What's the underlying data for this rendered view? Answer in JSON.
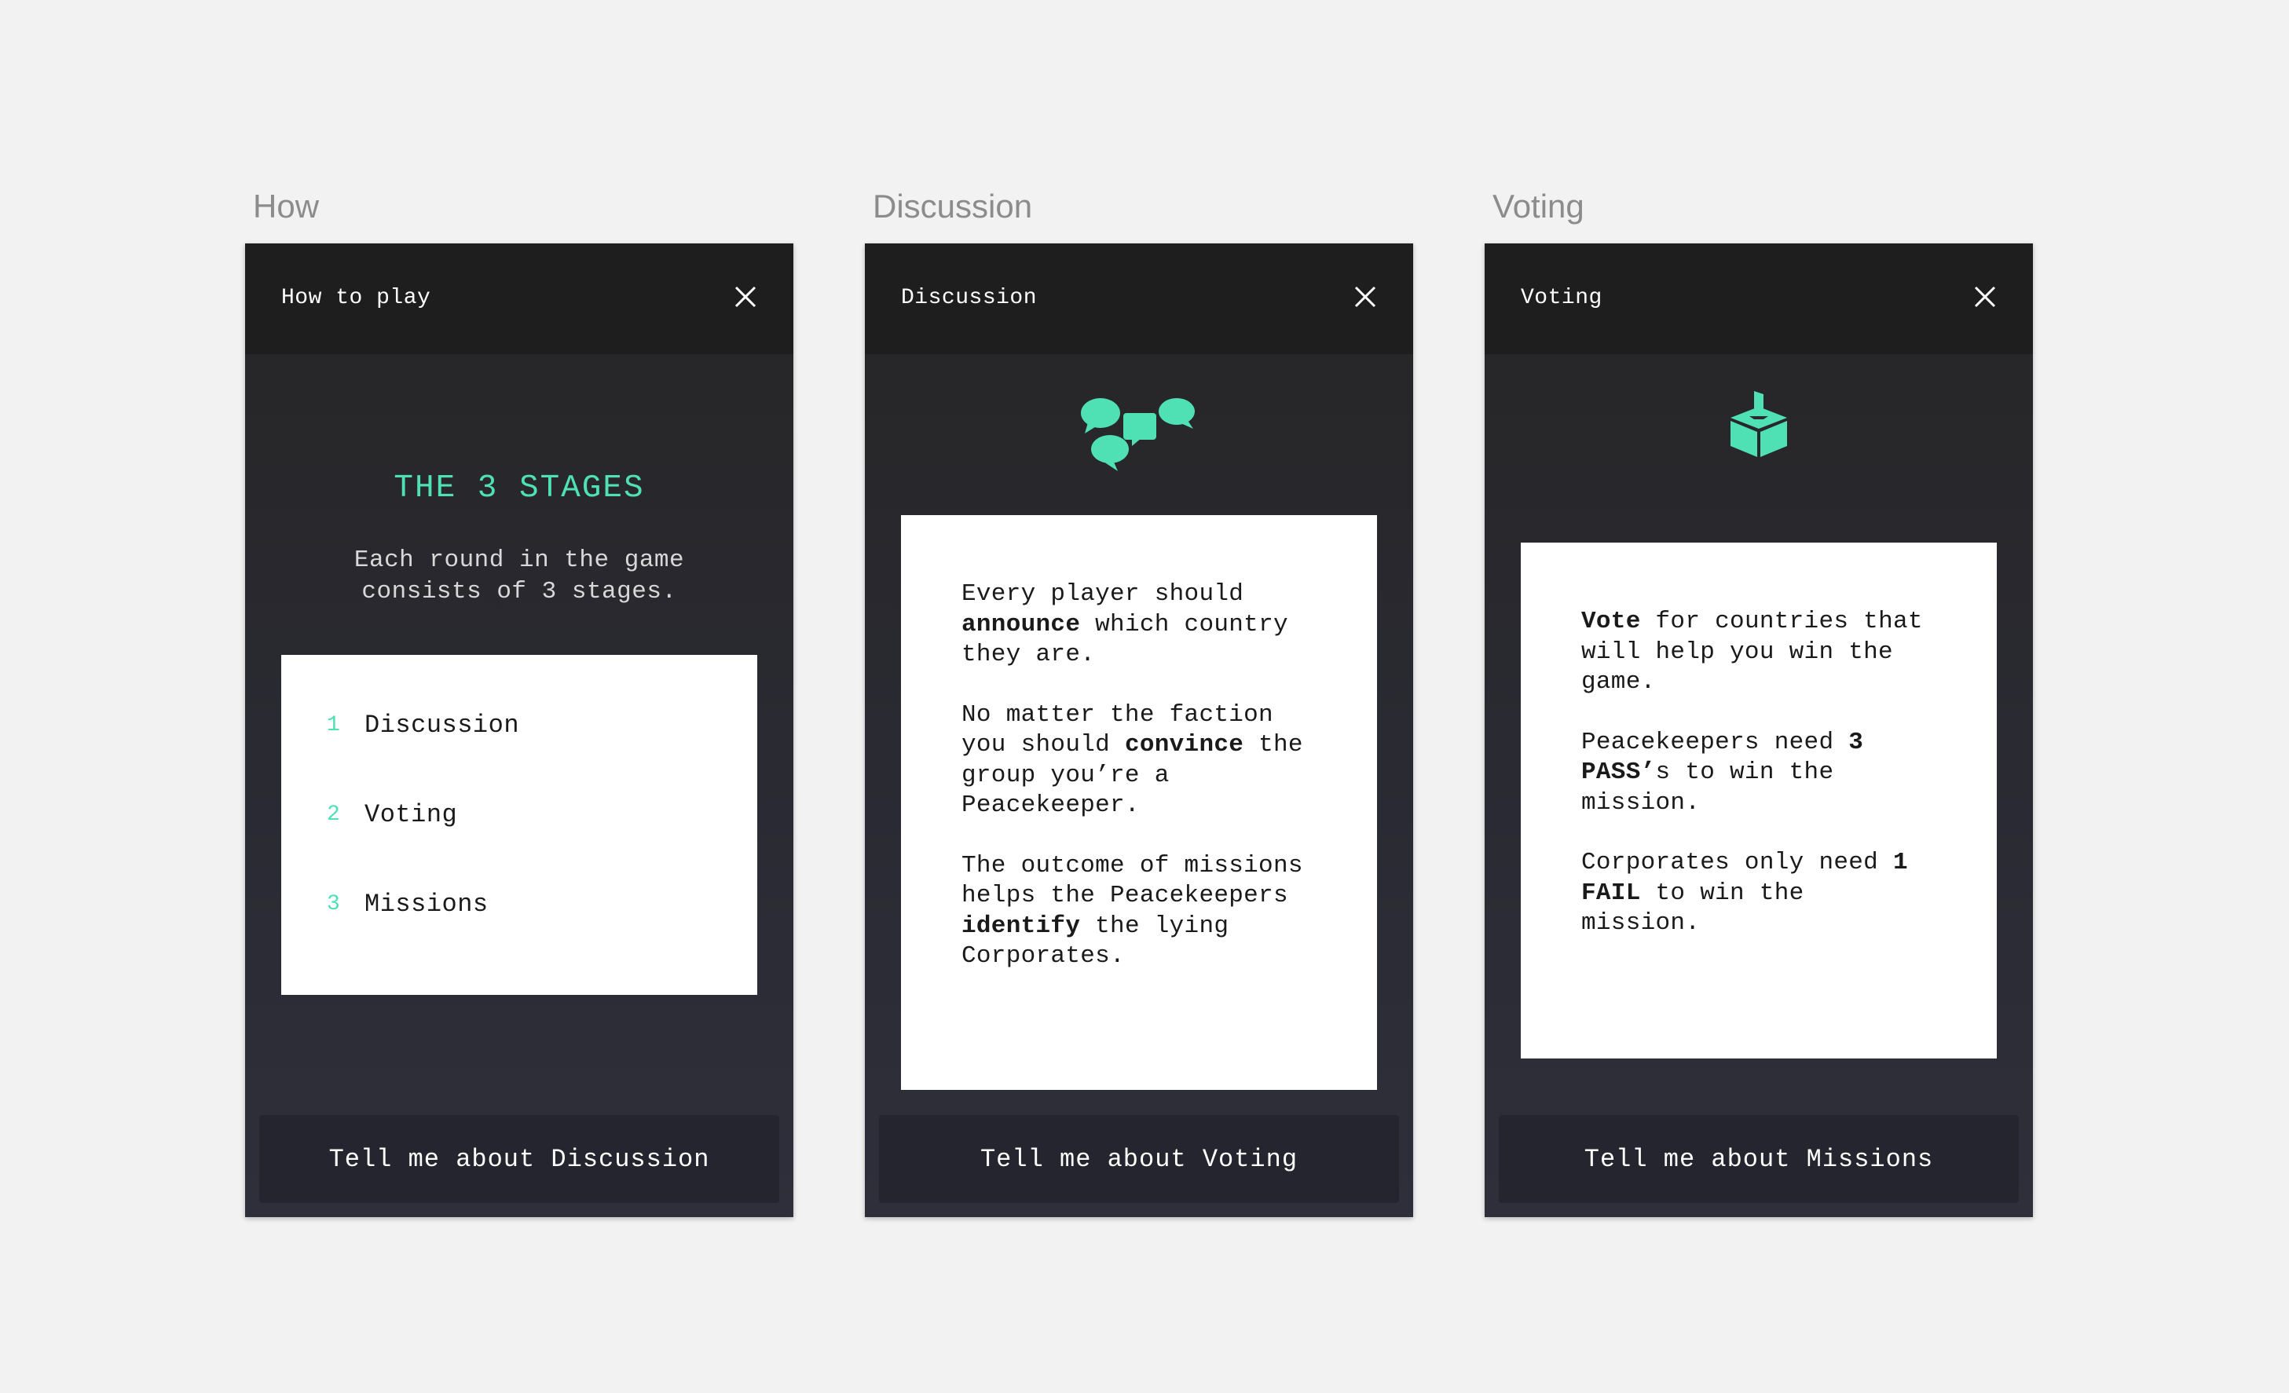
{
  "colors": {
    "background": "#f2f2f2",
    "accent": "#4fe0b4",
    "header": "#1e1e1e",
    "footer_button": "#25252f"
  },
  "frames": [
    {
      "label": "How",
      "header_title": "How to play",
      "heading": "THE 3 STAGES",
      "subtitle_line1": "Each round in the game",
      "subtitle_line2": "consists of 3 stages.",
      "stages": [
        {
          "num": "1",
          "label": "Discussion"
        },
        {
          "num": "2",
          "label": "Voting"
        },
        {
          "num": "3",
          "label": "Missions"
        }
      ],
      "footer_button": "Tell me about Discussion"
    },
    {
      "label": "Discussion",
      "header_title": "Discussion",
      "icon": "speech-bubbles-icon",
      "paragraphs": [
        {
          "l1": "Every player should",
          "l2_bold": "announce",
          "l2_rest": " which country",
          "l3": "they are."
        },
        {
          "l1": "No matter the faction",
          "l2_pre": "you should ",
          "l2_bold": "convince",
          "l2_post": " the",
          "l3": "group you’re a",
          "l4": "Peacekeeper."
        },
        {
          "l1": "The outcome of missions",
          "l2": "helps the Peacekeepers",
          "l3_bold": "identify",
          "l3_rest": " the lying",
          "l4": "Corporates."
        }
      ],
      "footer_button": "Tell me about Voting"
    },
    {
      "label": "Voting",
      "header_title": "Voting",
      "icon": "ballot-box-icon",
      "paragraphs": [
        {
          "l1_bold": "Vote",
          "l1_rest": " for countries that",
          "l2": "will help you win the",
          "l3": "game."
        },
        {
          "l1_pre": "Peacekeepers need ",
          "l1_bold": "3",
          "l2_bold": "PASS’",
          "l2_rest": "s to win the",
          "l3": "mission."
        },
        {
          "l1_pre": "Corporates only need ",
          "l1_bold": "1",
          "l2_bold": "FAIL",
          "l2_rest": " to win the",
          "l3": "mission."
        }
      ],
      "footer_button": "Tell me about Missions"
    }
  ]
}
